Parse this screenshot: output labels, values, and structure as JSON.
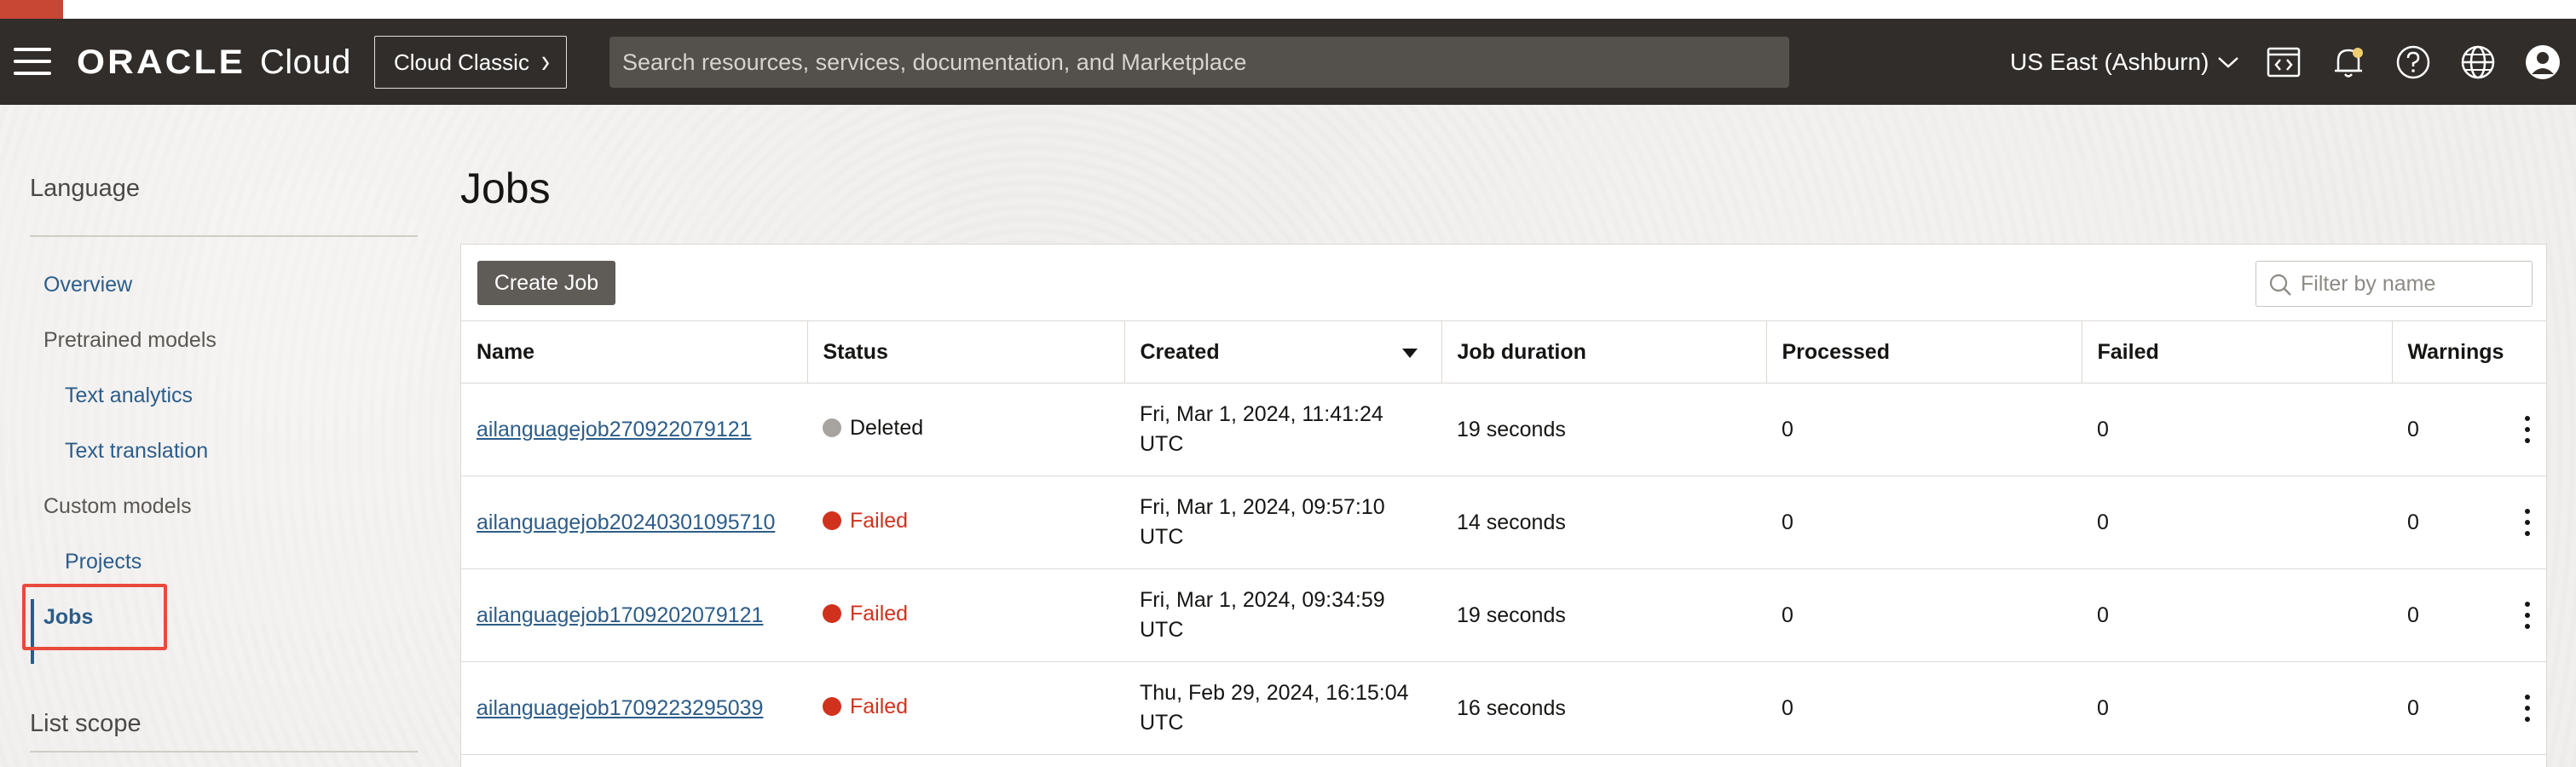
{
  "header": {
    "logo_oracle": "ORACLE",
    "logo_cloud": "Cloud",
    "classic_button": "Cloud Classic",
    "search_placeholder": "Search resources, services, documentation, and Marketplace",
    "region": "US East (Ashburn)"
  },
  "sidebar": {
    "title": "Language",
    "items": [
      {
        "label": "Overview",
        "type": "link"
      },
      {
        "label": "Pretrained models",
        "type": "heading"
      },
      {
        "label": "Text analytics",
        "type": "link"
      },
      {
        "label": "Text translation",
        "type": "link"
      },
      {
        "label": "Custom models",
        "type": "heading"
      },
      {
        "label": "Projects",
        "type": "link"
      },
      {
        "label": "Jobs",
        "type": "active"
      }
    ],
    "scope_title": "List scope"
  },
  "main": {
    "title": "Jobs",
    "create_button": "Create Job",
    "filter_placeholder": "Filter by name",
    "columns": [
      "Name",
      "Status",
      "Created",
      "Job duration",
      "Processed",
      "Failed",
      "Warnings"
    ],
    "rows": [
      {
        "name": "ailanguagejob270922079121",
        "status": "Deleted",
        "created_line1": "Fri, Mar 1, 2024, 11:41:24",
        "created_line2": "UTC",
        "duration": "19 seconds",
        "processed": "0",
        "failed": "0",
        "warnings": "0"
      },
      {
        "name": "ailanguagejob20240301095710",
        "status": "Failed",
        "created_line1": "Fri, Mar 1, 2024, 09:57:10",
        "created_line2": "UTC",
        "duration": "14 seconds",
        "processed": "0",
        "failed": "0",
        "warnings": "0"
      },
      {
        "name": "ailanguagejob1709202079121",
        "status": "Failed",
        "created_line1": "Fri, Mar 1, 2024, 09:34:59",
        "created_line2": "UTC",
        "duration": "19 seconds",
        "processed": "0",
        "failed": "0",
        "warnings": "0"
      },
      {
        "name": "ailanguagejob1709223295039",
        "status": "Failed",
        "created_line1": "Thu, Feb 29, 2024, 16:15:04",
        "created_line2": "UTC",
        "duration": "16 seconds",
        "processed": "0",
        "failed": "0",
        "warnings": "0"
      }
    ]
  },
  "colors": {
    "header_bg": "#312d2a",
    "brand_red": "#c74634",
    "link": "#2c5d8a",
    "failed": "#d0321e",
    "deleted_dot": "#a7a4a0",
    "highlight": "#e84a3b"
  },
  "icons": [
    "hamburger-icon",
    "chevron-right-icon",
    "chevron-down-icon",
    "code-editor-icon",
    "notification-bell-icon",
    "help-icon",
    "globe-icon",
    "user-avatar-icon",
    "search-icon",
    "sort-descending-icon",
    "kebab-menu-icon"
  ]
}
